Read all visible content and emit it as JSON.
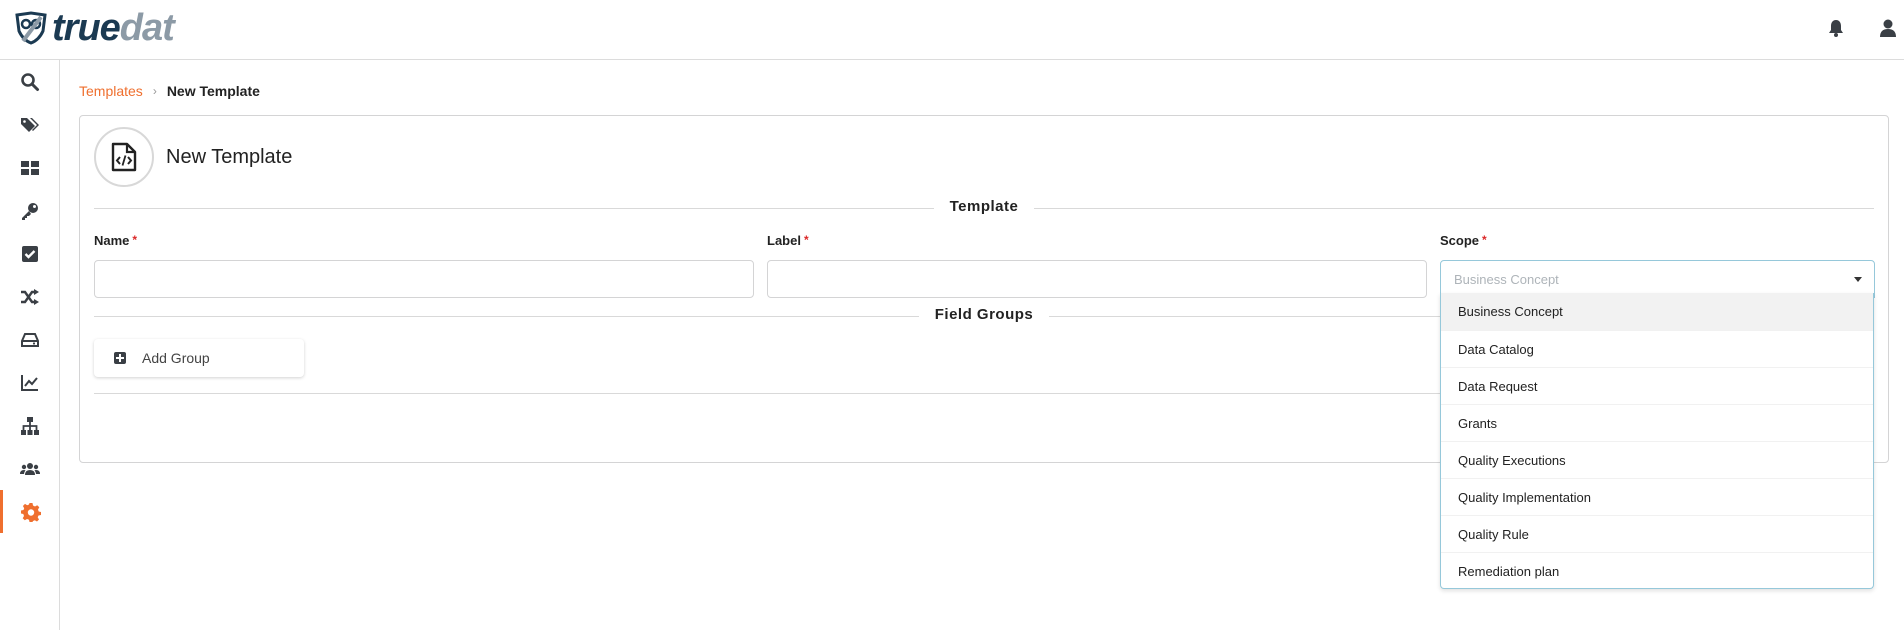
{
  "app": {
    "logo_true": "true",
    "logo_dat": "dat"
  },
  "header": {
    "icons": [
      "bell-icon",
      "user-icon"
    ]
  },
  "sidebar": {
    "items": [
      {
        "icon": "search-icon",
        "active": false
      },
      {
        "icon": "tags-icon",
        "active": false
      },
      {
        "icon": "grid-icon",
        "active": false
      },
      {
        "icon": "key-icon",
        "active": false
      },
      {
        "icon": "check-square-icon",
        "active": false
      },
      {
        "icon": "shuffle-icon",
        "active": false
      },
      {
        "icon": "hdd-icon",
        "active": false
      },
      {
        "icon": "chart-line-icon",
        "active": false
      },
      {
        "icon": "sitemap-icon",
        "active": false
      },
      {
        "icon": "users-icon",
        "active": false
      },
      {
        "icon": "gear-icon",
        "active": true
      }
    ],
    "active_color": "#ef6f2e"
  },
  "breadcrumb": {
    "parent": "Templates",
    "current": "New Template"
  },
  "page": {
    "title": "New Template",
    "icon": "file-code-icon"
  },
  "form": {
    "section_template": "Template",
    "name_label": "Name",
    "name_value": "",
    "label_label": "Label",
    "label_value": "",
    "scope_label": "Scope",
    "scope_placeholder": "Business Concept",
    "required_mark": "*",
    "section_field_groups": "Field Groups",
    "add_group_label": "Add Group"
  },
  "scope_options": [
    "Business Concept",
    "Data Catalog",
    "Data Request",
    "Grants",
    "Quality Executions",
    "Quality Implementation",
    "Quality Rule",
    "Remediation plan"
  ],
  "colors": {
    "accent": "#ef6f2e",
    "required": "#db2828",
    "focus_border": "#96c8da",
    "logo_dark": "#1b3a52",
    "logo_light": "#8c9aa6"
  }
}
